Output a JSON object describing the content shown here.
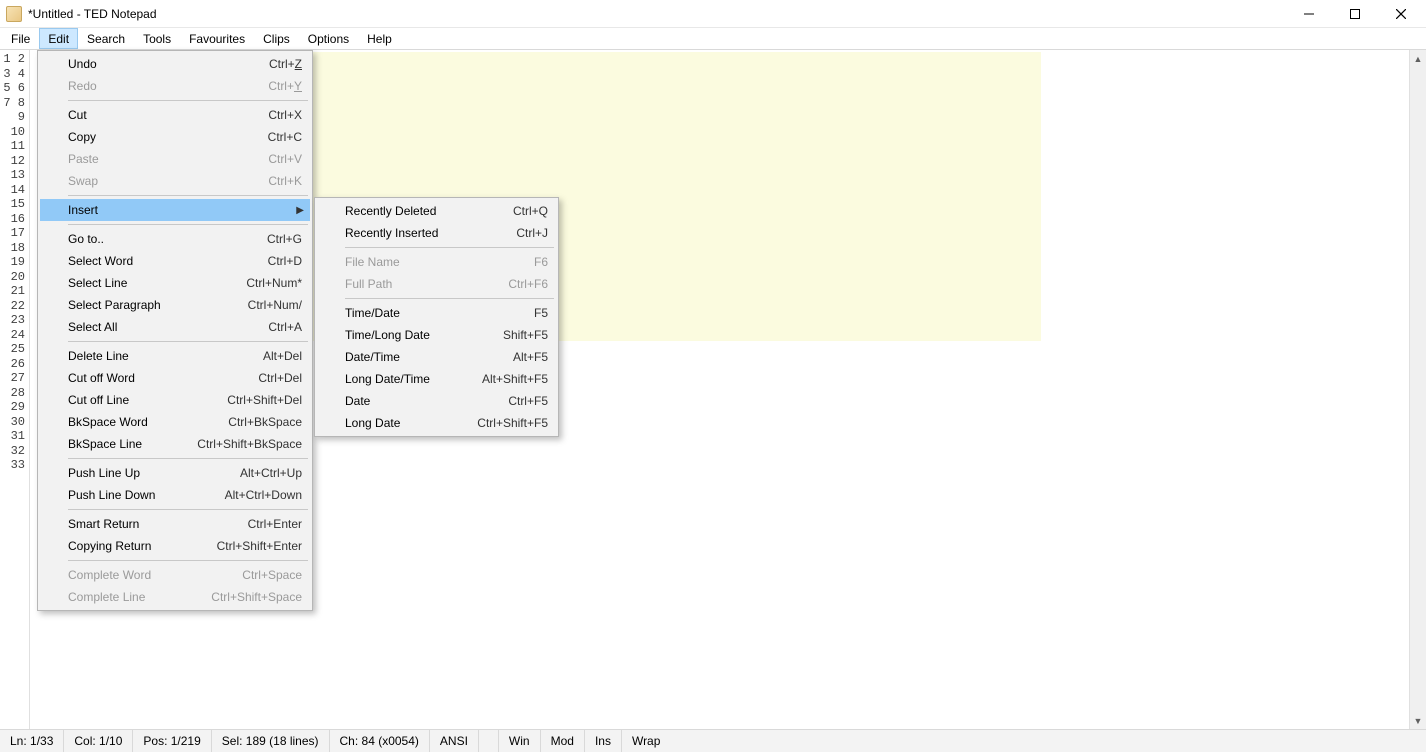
{
  "window": {
    "title": "*Untitled - TED Notepad"
  },
  "menubar": [
    "File",
    "Edit",
    "Search",
    "Tools",
    "Favourites",
    "Clips",
    "Options",
    "Help"
  ],
  "menubar_open_index": 1,
  "gutter_lines": 33,
  "edit_menu": [
    {
      "label": "Undo",
      "shortcut": "Ctrl+Z",
      "underline": "Z"
    },
    {
      "label": "Redo",
      "shortcut": "Ctrl+Y",
      "underline": "Y",
      "disabled": true
    },
    {
      "sep": true
    },
    {
      "label": "Cut",
      "shortcut": "Ctrl+X"
    },
    {
      "label": "Copy",
      "shortcut": "Ctrl+C"
    },
    {
      "label": "Paste",
      "shortcut": "Ctrl+V",
      "disabled": true
    },
    {
      "label": "Swap",
      "shortcut": "Ctrl+K",
      "disabled": true
    },
    {
      "sep": true
    },
    {
      "label": "Insert",
      "submenu": true,
      "highlight": true
    },
    {
      "sep": true
    },
    {
      "label": "Go to..",
      "shortcut": "Ctrl+G"
    },
    {
      "label": "Select Word",
      "shortcut": "Ctrl+D"
    },
    {
      "label": "Select Line",
      "shortcut": "Ctrl+Num*"
    },
    {
      "label": "Select Paragraph",
      "shortcut": "Ctrl+Num/"
    },
    {
      "label": "Select All",
      "shortcut": "Ctrl+A"
    },
    {
      "sep": true
    },
    {
      "label": "Delete Line",
      "shortcut": "Alt+Del"
    },
    {
      "label": "Cut off Word",
      "shortcut": "Ctrl+Del"
    },
    {
      "label": "Cut off Line",
      "shortcut": "Ctrl+Shift+Del"
    },
    {
      "label": "BkSpace Word",
      "shortcut": "Ctrl+BkSpace"
    },
    {
      "label": "BkSpace Line",
      "shortcut": "Ctrl+Shift+BkSpace"
    },
    {
      "sep": true
    },
    {
      "label": "Push Line Up",
      "shortcut": "Alt+Ctrl+Up"
    },
    {
      "label": "Push Line Down",
      "shortcut": "Alt+Ctrl+Down"
    },
    {
      "sep": true
    },
    {
      "label": "Smart Return",
      "shortcut": "Ctrl+Enter"
    },
    {
      "label": "Copying Return",
      "shortcut": "Ctrl+Shift+Enter"
    },
    {
      "sep": true
    },
    {
      "label": "Complete Word",
      "shortcut": "Ctrl+Space",
      "disabled": true
    },
    {
      "label": "Complete Line",
      "shortcut": "Ctrl+Shift+Space",
      "disabled": true
    }
  ],
  "insert_submenu": [
    {
      "label": "Recently Deleted",
      "shortcut": "Ctrl+Q"
    },
    {
      "label": "Recently Inserted",
      "shortcut": "Ctrl+J"
    },
    {
      "sep": true
    },
    {
      "label": "File Name",
      "shortcut": "F6",
      "disabled": true
    },
    {
      "label": "Full Path",
      "shortcut": "Ctrl+F6",
      "disabled": true
    },
    {
      "sep": true
    },
    {
      "label": "Time/Date",
      "shortcut": "F5"
    },
    {
      "label": "Time/Long Date",
      "shortcut": "Shift+F5"
    },
    {
      "label": "Date/Time",
      "shortcut": "Alt+F5"
    },
    {
      "label": "Long Date/Time",
      "shortcut": "Alt+Shift+F5"
    },
    {
      "label": "Date",
      "shortcut": "Ctrl+F5"
    },
    {
      "label": "Long Date",
      "shortcut": "Ctrl+Shift+F5"
    }
  ],
  "status": {
    "ln": "Ln: 1/33",
    "col": "Col: 1/10",
    "pos": "Pos: 1/219",
    "sel": "Sel: 189 (18 lines)",
    "ch": "Ch: 84 (x0054)",
    "enc": "ANSI",
    "win": "Win",
    "mod": "Mod",
    "ins": "Ins",
    "wrap": "Wrap"
  }
}
